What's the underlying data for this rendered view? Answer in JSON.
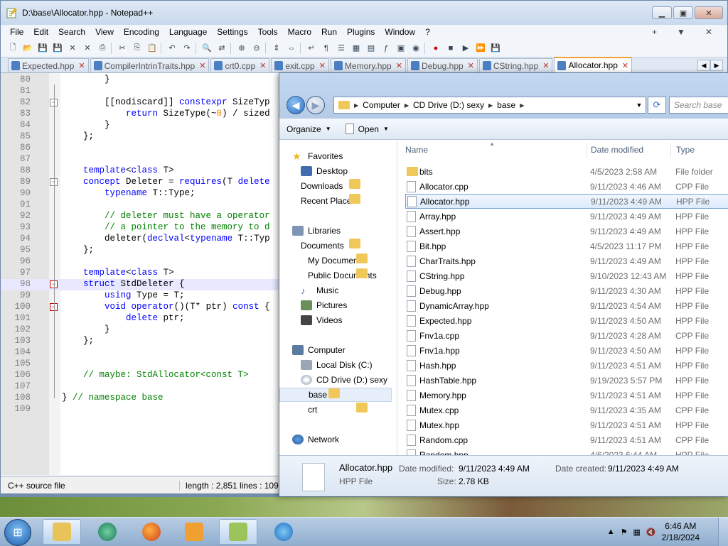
{
  "notepad": {
    "title": "D:\\base\\Allocator.hpp - Notepad++",
    "menu": [
      "File",
      "Edit",
      "Search",
      "View",
      "Encoding",
      "Language",
      "Settings",
      "Tools",
      "Macro",
      "Run",
      "Plugins",
      "Window",
      "?"
    ],
    "menu_right": [
      "+",
      "▼",
      "✕"
    ],
    "tabs": [
      "Expected.hpp",
      "CompilerIntrinTraits.hpp",
      "crt0.cpp",
      "exit.cpp",
      "Memory.hpp",
      "Debug.hpp",
      "CString.hpp",
      "Allocator.hpp"
    ],
    "active_tab": "Allocator.hpp",
    "lines": [
      {
        "n": "80",
        "code": "        }"
      },
      {
        "n": "81",
        "code": ""
      },
      {
        "n": "82",
        "code": "        [[nodiscard]] constexpr SizeTyp"
      },
      {
        "n": "83",
        "code": "            return SizeType(~0) / sized"
      },
      {
        "n": "84",
        "code": "        }"
      },
      {
        "n": "85",
        "code": "    };"
      },
      {
        "n": "86",
        "code": ""
      },
      {
        "n": "87",
        "code": ""
      },
      {
        "n": "88",
        "code": "    template<class T>"
      },
      {
        "n": "89",
        "code": "    concept Deleter = requires(T delete"
      },
      {
        "n": "90",
        "code": "        typename T::Type;"
      },
      {
        "n": "91",
        "code": ""
      },
      {
        "n": "92",
        "code": "        // deleter must have a operator"
      },
      {
        "n": "93",
        "code": "        // a pointer to the memory to d"
      },
      {
        "n": "94",
        "code": "        deleter(declval<typename T::Typ"
      },
      {
        "n": "95",
        "code": "    };"
      },
      {
        "n": "96",
        "code": ""
      },
      {
        "n": "97",
        "code": "    template<class T>"
      },
      {
        "n": "98",
        "code": "    struct StdDeleter {"
      },
      {
        "n": "99",
        "code": "        using Type = T;"
      },
      {
        "n": "100",
        "code": "        void operator()(T* ptr) const {"
      },
      {
        "n": "101",
        "code": "            delete ptr;"
      },
      {
        "n": "102",
        "code": "        }"
      },
      {
        "n": "103",
        "code": "    };"
      },
      {
        "n": "104",
        "code": ""
      },
      {
        "n": "105",
        "code": ""
      },
      {
        "n": "106",
        "code": "    // maybe: StdAllocator<const T>"
      },
      {
        "n": "107",
        "code": ""
      },
      {
        "n": "108",
        "code": "} // namespace base"
      },
      {
        "n": "109",
        "code": ""
      }
    ],
    "status": {
      "filetype": "C++ source file",
      "length": "length : 2,851    lines : 109"
    }
  },
  "explorer": {
    "path": [
      "Computer",
      "CD Drive (D:) sexy",
      "base"
    ],
    "search_placeholder": "Search base",
    "commands": {
      "organize": "Organize",
      "open": "Open"
    },
    "nav": {
      "favorites": "Favorites",
      "fav_items": [
        "Desktop",
        "Downloads",
        "Recent Places"
      ],
      "libraries": "Libraries",
      "lib_items": [
        "Documents",
        "My Documents",
        "Public Documents",
        "Music",
        "Pictures",
        "Videos"
      ],
      "computer": "Computer",
      "comp_items": [
        "Local Disk (C:)",
        "CD Drive (D:) sexy",
        "base",
        "crt"
      ],
      "network": "Network"
    },
    "columns": {
      "name": "Name",
      "date": "Date modified",
      "type": "Type"
    },
    "files": [
      {
        "name": "bits",
        "date": "4/5/2023 2:58 AM",
        "type": "File folder",
        "dir": true
      },
      {
        "name": "Allocator.cpp",
        "date": "9/11/2023 4:46 AM",
        "type": "CPP File"
      },
      {
        "name": "Allocator.hpp",
        "date": "9/11/2023 4:49 AM",
        "type": "HPP File",
        "selected": true
      },
      {
        "name": "Array.hpp",
        "date": "9/11/2023 4:49 AM",
        "type": "HPP File"
      },
      {
        "name": "Assert.hpp",
        "date": "9/11/2023 4:49 AM",
        "type": "HPP File"
      },
      {
        "name": "Bit.hpp",
        "date": "4/5/2023 11:17 PM",
        "type": "HPP File"
      },
      {
        "name": "CharTraits.hpp",
        "date": "9/11/2023 4:49 AM",
        "type": "HPP File"
      },
      {
        "name": "CString.hpp",
        "date": "9/10/2023 12:43 AM",
        "type": "HPP File"
      },
      {
        "name": "Debug.hpp",
        "date": "9/11/2023 4:30 AM",
        "type": "HPP File"
      },
      {
        "name": "DynamicArray.hpp",
        "date": "9/11/2023 4:54 AM",
        "type": "HPP File"
      },
      {
        "name": "Expected.hpp",
        "date": "9/11/2023 4:50 AM",
        "type": "HPP File"
      },
      {
        "name": "Fnv1a.cpp",
        "date": "9/11/2023 4:28 AM",
        "type": "CPP File"
      },
      {
        "name": "Fnv1a.hpp",
        "date": "9/11/2023 4:50 AM",
        "type": "HPP File"
      },
      {
        "name": "Hash.hpp",
        "date": "9/11/2023 4:51 AM",
        "type": "HPP File"
      },
      {
        "name": "HashTable.hpp",
        "date": "9/19/2023 5:57 PM",
        "type": "HPP File"
      },
      {
        "name": "Memory.hpp",
        "date": "9/11/2023 4:51 AM",
        "type": "HPP File"
      },
      {
        "name": "Mutex.cpp",
        "date": "9/11/2023 4:35 AM",
        "type": "CPP File"
      },
      {
        "name": "Mutex.hpp",
        "date": "9/11/2023 4:51 AM",
        "type": "HPP File"
      },
      {
        "name": "Random.cpp",
        "date": "9/11/2023 4:51 AM",
        "type": "CPP File"
      },
      {
        "name": "Random.hpp",
        "date": "4/6/2023 6:44 AM",
        "type": "HPP File"
      }
    ],
    "details": {
      "name": "Allocator.hpp",
      "type": "HPP File",
      "modified_label": "Date modified:",
      "modified": "9/11/2023 4:49 AM",
      "created_label": "Date created:",
      "created": "9/11/2023 4:49 AM",
      "size_label": "Size:",
      "size": "2.78 KB"
    }
  },
  "taskbar": {
    "time": "6:46 AM",
    "date": "2/18/2024"
  }
}
